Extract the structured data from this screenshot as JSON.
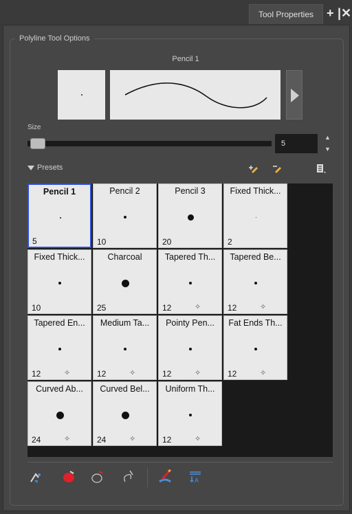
{
  "tab": {
    "title": "Tool Properties",
    "add_icon": "plus-icon",
    "close_icon": "close-icon"
  },
  "group": {
    "title": "Polyline Tool Options"
  },
  "preview": {
    "brush_name": "Pencil 1"
  },
  "size": {
    "label": "Size",
    "value": "5"
  },
  "presets": {
    "label": "Presets",
    "items": [
      {
        "name": "Pencil 1",
        "size": "5",
        "selected": true,
        "pressure": false
      },
      {
        "name": "Pencil 2",
        "size": "10",
        "pressure": false
      },
      {
        "name": "Pencil 3",
        "size": "20",
        "pressure": false
      },
      {
        "name": "Fixed Thick...",
        "size": "2",
        "pressure": false
      },
      {
        "name": "Fixed Thick...",
        "size": "10",
        "pressure": false
      },
      {
        "name": "Charcoal",
        "size": "25",
        "pressure": false
      },
      {
        "name": "Tapered Th...",
        "size": "12",
        "pressure": true
      },
      {
        "name": "Tapered Be...",
        "size": "12",
        "pressure": true
      },
      {
        "name": "Tapered En...",
        "size": "12",
        "pressure": true
      },
      {
        "name": "Medium Ta...",
        "size": "12",
        "pressure": true
      },
      {
        "name": "Pointy Pen...",
        "size": "12",
        "pressure": true
      },
      {
        "name": "Fat Ends Th...",
        "size": "12",
        "pressure": true
      },
      {
        "name": "Curved Ab...",
        "size": "24",
        "pressure": true
      },
      {
        "name": "Curved Bel...",
        "size": "24",
        "pressure": true
      },
      {
        "name": "Uniform Th...",
        "size": "12",
        "pressure": true
      }
    ]
  },
  "colors": {
    "accent": "#2b4fd6",
    "panel": "#464646",
    "grid_bg": "#1a1a1a",
    "cell_bg": "#e9e9e9"
  }
}
